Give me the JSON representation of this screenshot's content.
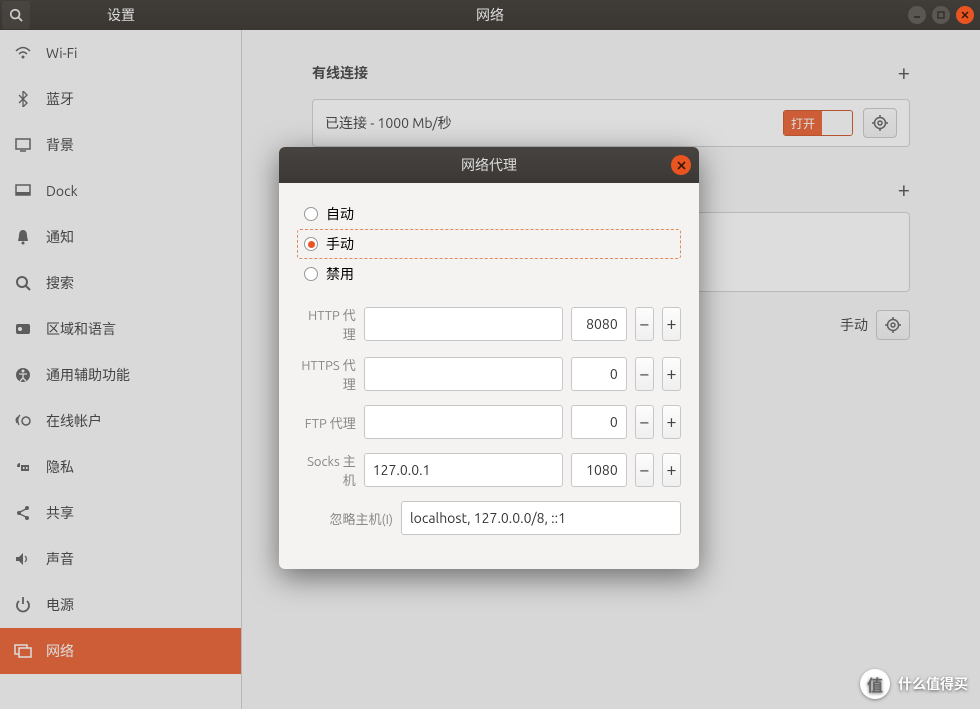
{
  "titlebar": {
    "settings": "设置",
    "main_title": "网络"
  },
  "sidebar": {
    "items": [
      {
        "label": "Wi-Fi",
        "icon": "wifi"
      },
      {
        "label": "蓝牙",
        "icon": "bluetooth"
      },
      {
        "label": "背景",
        "icon": "background"
      },
      {
        "label": "Dock",
        "icon": "dock"
      },
      {
        "label": "通知",
        "icon": "bell"
      },
      {
        "label": "搜索",
        "icon": "search"
      },
      {
        "label": "区域和语言",
        "icon": "region"
      },
      {
        "label": "通用辅助功能",
        "icon": "accessibility"
      },
      {
        "label": "在线帐户",
        "icon": "online"
      },
      {
        "label": "隐私",
        "icon": "privacy"
      },
      {
        "label": "共享",
        "icon": "share"
      },
      {
        "label": "声音",
        "icon": "sound"
      },
      {
        "label": "电源",
        "icon": "power"
      },
      {
        "label": "网络",
        "icon": "network",
        "active": true
      }
    ]
  },
  "main": {
    "wired_title": "有线连接",
    "conn_status": "已连接 - 1000 Mb/秒",
    "switch_on": "打开",
    "proxy_mode_label": "手动"
  },
  "dialog": {
    "title": "网络代理",
    "opts": {
      "auto": "自动",
      "manual": "手动",
      "disabled": "禁用"
    },
    "http_label": "HTTP 代理",
    "http_host": "",
    "http_port": "8080",
    "https_label": "HTTPS 代理",
    "https_host": "",
    "https_port": "0",
    "ftp_label": "FTP 代理",
    "ftp_host": "",
    "ftp_port": "0",
    "socks_label": "Socks 主机",
    "socks_host": "127.0.0.1",
    "socks_port": "1080",
    "ignore_label": "忽略主机(I)",
    "ignore_value": "localhost, 127.0.0.0/8, ::1"
  },
  "watermark": "什么值得买"
}
